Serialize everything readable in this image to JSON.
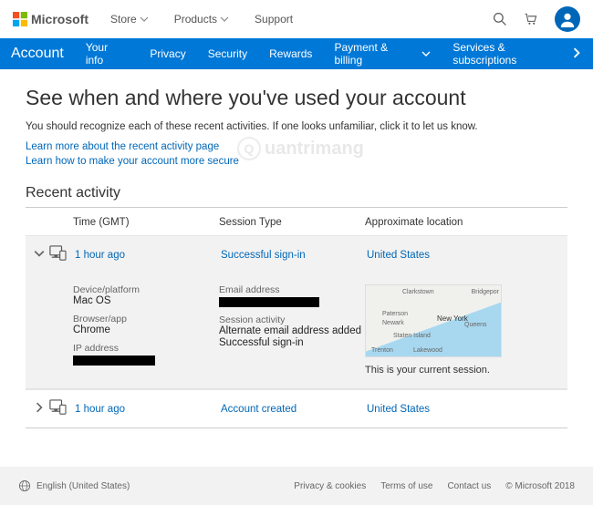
{
  "brand": {
    "name": "Microsoft"
  },
  "topnav": {
    "store": "Store",
    "products": "Products",
    "support": "Support"
  },
  "bluebar": {
    "account": "Account",
    "items": [
      "Your info",
      "Privacy",
      "Security",
      "Rewards",
      "Payment & billing",
      "Services & subscriptions"
    ]
  },
  "page": {
    "title": "See when and where you've used your account",
    "intro": "You should recognize each of these recent activities. If one looks unfamiliar, click it to let us know.",
    "link1": "Learn more about the recent activity page",
    "link2": "Learn how to make your account more secure",
    "section": "Recent activity"
  },
  "columns": {
    "time": "Time (GMT)",
    "session": "Session Type",
    "location": "Approximate location"
  },
  "rows": [
    {
      "time": "1 hour ago",
      "session": "Successful sign-in",
      "location": "United States",
      "expanded": true
    },
    {
      "time": "1 hour ago",
      "session": "Account created",
      "location": "United States",
      "expanded": false
    }
  ],
  "details": {
    "device_label": "Device/platform",
    "device_value": "Mac OS",
    "browser_label": "Browser/app",
    "browser_value": "Chrome",
    "ip_label": "IP address",
    "email_label": "Email address",
    "activity_label": "Session activity",
    "activity_value1": "Alternate email address added",
    "activity_value2": "Successful sign-in",
    "caption": "This is your current session."
  },
  "map": {
    "labels": [
      "Clarkstown",
      "Bridgepor",
      "Paterson",
      "Newark",
      "New York",
      "Queens",
      "Staten Island",
      "Trenton",
      "Lakewood"
    ]
  },
  "footer": {
    "language": "English (United States)",
    "links": [
      "Privacy & cookies",
      "Terms of use",
      "Contact us"
    ],
    "copyright": "© Microsoft 2018"
  },
  "watermark": {
    "text": "uantrimang"
  }
}
